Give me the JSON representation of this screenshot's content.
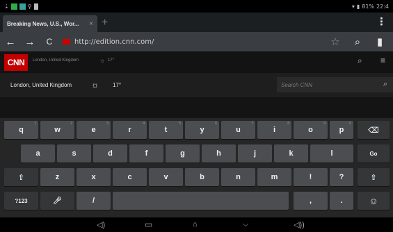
{
  "status_bar": {
    "battery": "81%",
    "time": "22:4"
  },
  "tabs": [
    {
      "title": "Breaking News, U.S., Wor...",
      "close": "×"
    }
  ],
  "new_tab": "+",
  "toolbar": {
    "back": "←",
    "forward": "→",
    "reload": "C",
    "url": "http://edition.cnn.com/",
    "star": "☆",
    "search": "⌕",
    "bookmark": "▮"
  },
  "cnn_header": {
    "logo": "CNN",
    "location": "London, United Kingdom",
    "temp": "17°"
  },
  "subbar": {
    "location": "London, United Kingdom",
    "temp": "17°",
    "search_placeholder": "Search CNN"
  },
  "keyboard": {
    "row1": [
      {
        "label": "q",
        "hint": "1"
      },
      {
        "label": "w",
        "hint": "2"
      },
      {
        "label": "e",
        "hint": "3"
      },
      {
        "label": "r",
        "hint": "4"
      },
      {
        "label": "t",
        "hint": "5"
      },
      {
        "label": "y",
        "hint": "6"
      },
      {
        "label": "u",
        "hint": "7"
      },
      {
        "label": "i",
        "hint": "8"
      },
      {
        "label": "o",
        "hint": "9"
      },
      {
        "label": "p",
        "hint": "0"
      }
    ],
    "row2": [
      "a",
      "s",
      "d",
      "f",
      "g",
      "h",
      "j",
      "k",
      "l"
    ],
    "row3": [
      "z",
      "x",
      "c",
      "v",
      "b",
      "n",
      "m",
      "!",
      "?"
    ],
    "backspace": "⌫",
    "go": "Go",
    "shift": "⇧",
    "symbols": "?123",
    "mic": "🎙",
    "slash": "/",
    "comma": ",",
    "period": ".",
    "emoji": "☺"
  },
  "navbar": {
    "vol_down": "🔈",
    "recents": "▭",
    "home": "⌂",
    "hide_kb": "︶",
    "vol_up": "🔊"
  },
  "colors": {
    "cnn_red": "#c30000",
    "key": "#4b4d50",
    "keyboard_bg": "#262626"
  }
}
